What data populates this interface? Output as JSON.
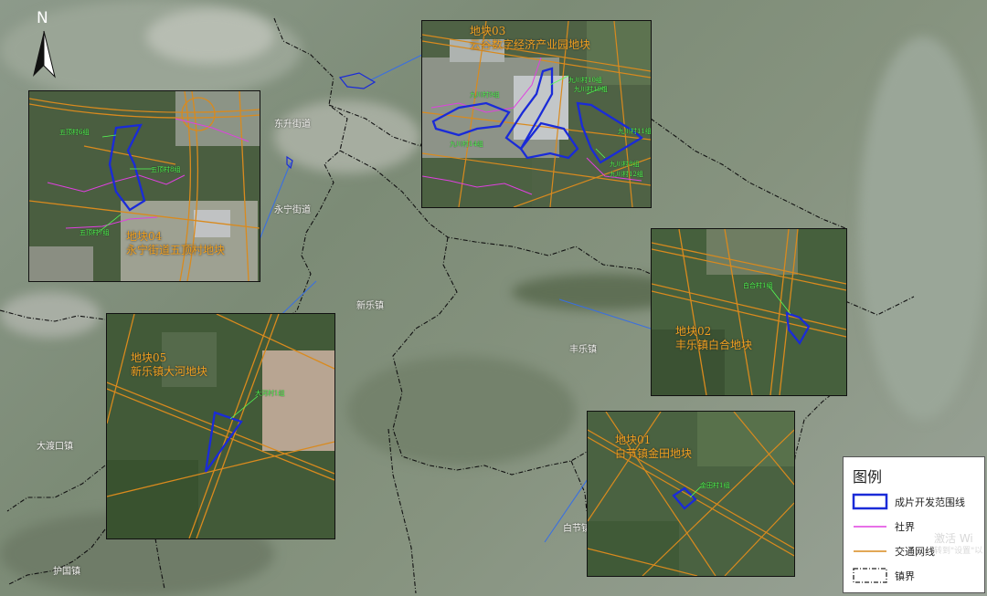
{
  "north_label": "N",
  "places": {
    "dongsheng": "东升街道",
    "yongning": "永宁街道",
    "xinle": "新乐镇",
    "fengle": "丰乐镇",
    "dadukou": "大渡口镇",
    "baijie": "白节镇",
    "huguo": "护国镇"
  },
  "plots": {
    "plot03": {
      "code": "地块03",
      "name": "云谷数字经济产业园地块"
    },
    "plot04": {
      "code": "地块04",
      "name": "永宁街道五顶村地块"
    },
    "plot05": {
      "code": "地块05",
      "name": "新乐镇大河地块"
    },
    "plot02": {
      "code": "地块02",
      "name": "丰乐镇白合地块"
    },
    "plot01": {
      "code": "地块01",
      "name": "白节镇金田地块"
    }
  },
  "callouts": {
    "wuding6": "五顶村6组",
    "wuding8": "五顶村8组",
    "wuding7": "五顶村7组",
    "jiuchuan10": "九川村10组",
    "jiuchuan19": "九川村19组",
    "jiuchuan11": "九川村11组",
    "jiuchuan14": "九川村14组",
    "jiuchuan8": "九川村8组",
    "jiuchuan12": "九川村12组",
    "jiuchuan9": "九川村9组",
    "baihe1": "白合村1组",
    "dahe1": "大河村1组",
    "jintian1": "金田村1组"
  },
  "legend": {
    "title": "图例",
    "items": [
      {
        "label": "成片开发范围线",
        "symbol": "blue-rect-symbol",
        "color": "#1a2bd8"
      },
      {
        "label": "社界",
        "symbol": "magenta-line-symbol",
        "color": "#e040e0"
      },
      {
        "label": "交通网线",
        "symbol": "orange-line-symbol",
        "color": "#d98a1e"
      },
      {
        "label": "镇界",
        "symbol": "dashed-rect-symbol",
        "color": "#222222"
      }
    ]
  },
  "watermark": {
    "line1": "激活 Wi",
    "line2": "转到\"设置\"以"
  },
  "colors": {
    "boundary_blue": "#1a2bd8",
    "community_magenta": "#e040e0",
    "road_orange": "#d98a1e",
    "plot_title_orange": "#f0a020",
    "callout_green": "#54ff54",
    "leader_blue": "#3a6fe0"
  }
}
